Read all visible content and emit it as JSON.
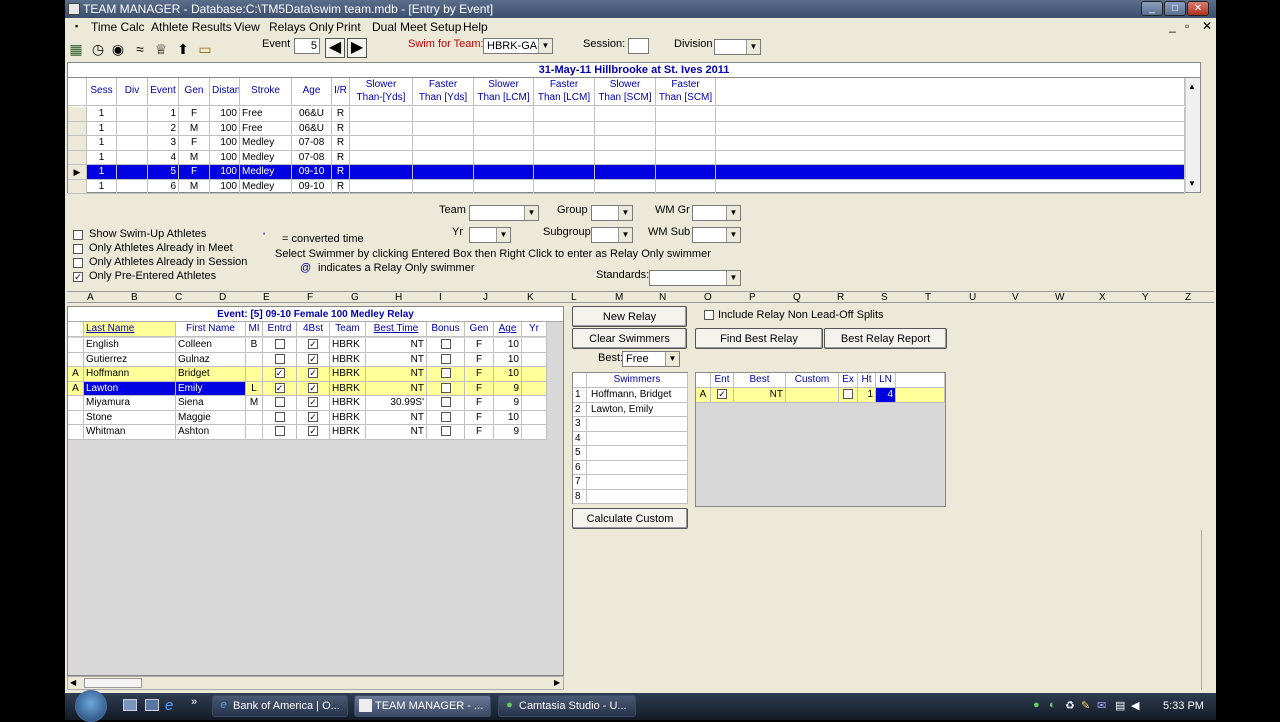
{
  "window": {
    "title": "TEAM MANAGER - Database:C:\\TM5Data\\swim team.mdb - [Entry by Event]"
  },
  "menu": [
    "Time Calc",
    "Athlete Results",
    "View",
    "Relays Only",
    "Print",
    "Dual Meet Setup",
    "Help"
  ],
  "toolbar": {
    "event_label": "Event",
    "event_value": "5",
    "swim_for_team_label": "Swim for Team:",
    "swim_for_team_value": "HBRK-GA",
    "session_label": "Session:",
    "division_label": "Division"
  },
  "meet": {
    "banner": "31-May-11  Hillbrooke at St. Ives 2011"
  },
  "events_grid": {
    "headers": [
      "Sess",
      "Div",
      "Event",
      "Gen",
      "Distance",
      "Stroke",
      "Age",
      "I/R",
      "Slower Than-[Yds]",
      "Faster Than [Yds]",
      "Slower Than [LCM]",
      "Faster Than [LCM]",
      "Slower Than [SCM]",
      "Faster Than [SCM]"
    ],
    "header_lines": [
      [
        "Sess"
      ],
      [
        "Div"
      ],
      [
        "Event"
      ],
      [
        "Gen"
      ],
      [
        "Distance"
      ],
      [
        "Stroke"
      ],
      [
        "Age"
      ],
      [
        "I/R"
      ],
      [
        "Slower",
        "Than-[Yds]"
      ],
      [
        "Faster",
        "Than [Yds]"
      ],
      [
        "Slower",
        "Than [LCM]"
      ],
      [
        "Faster",
        "Than [LCM]"
      ],
      [
        "Slower",
        "Than [SCM]"
      ],
      [
        "Faster",
        "Than [SCM]"
      ]
    ],
    "rows": [
      {
        "sess": "1",
        "div": "",
        "event": "1",
        "gen": "F",
        "distance": "100",
        "stroke": "Free",
        "age": "06&U",
        "ir": "R"
      },
      {
        "sess": "1",
        "div": "",
        "event": "2",
        "gen": "M",
        "distance": "100",
        "stroke": "Free",
        "age": "06&U",
        "ir": "R"
      },
      {
        "sess": "1",
        "div": "",
        "event": "3",
        "gen": "F",
        "distance": "100",
        "stroke": "Medley",
        "age": "07-08",
        "ir": "R"
      },
      {
        "sess": "1",
        "div": "",
        "event": "4",
        "gen": "M",
        "distance": "100",
        "stroke": "Medley",
        "age": "07-08",
        "ir": "R"
      },
      {
        "sess": "1",
        "div": "",
        "event": "5",
        "gen": "F",
        "distance": "100",
        "stroke": "Medley",
        "age": "09-10",
        "ir": "R"
      },
      {
        "sess": "1",
        "div": "",
        "event": "6",
        "gen": "M",
        "distance": "100",
        "stroke": "Medley",
        "age": "09-10",
        "ir": "R"
      }
    ],
    "selected_index": 4
  },
  "filters": {
    "show_swimup": "Show Swim-Up Athletes",
    "only_in_meet": "Only Athletes Already in Meet",
    "only_in_session": "Only Athletes Already in Session",
    "only_preentered": "Only Pre-Entered Athletes",
    "team_label": "Team",
    "group_label": "Group",
    "wm_gr_label": "WM Gr",
    "yr_label": "Yr",
    "subgroup_label": "Subgroup",
    "wm_sub_label": "WM Sub",
    "standards_label": "Standards:",
    "converted_mark": "'",
    "converted_note": "= converted time",
    "instructions": "Select Swimmer by clicking Entered Box then Right Click to enter as Relay Only swimmer",
    "relay_only_mark": "@",
    "relay_only_note": "indicates a Relay Only swimmer"
  },
  "column_letters": [
    "A",
    "B",
    "C",
    "D",
    "E",
    "F",
    "G",
    "H",
    "I",
    "J",
    "K",
    "L",
    "M",
    "N",
    "O",
    "P",
    "Q",
    "R",
    "S",
    "T",
    "U",
    "V",
    "W",
    "X",
    "Y",
    "Z"
  ],
  "athletes": {
    "event_title": "Event: [5]  09-10  Female  100  Medley Relay",
    "headers": [
      "Last Name",
      "First Name",
      "MI",
      "Entrd",
      "4Bst",
      "Team",
      "Best Time",
      "Bonus",
      "Gen",
      "Age",
      "Yr"
    ],
    "rows": [
      {
        "mark": "",
        "last": "English",
        "first": "Colleen",
        "mi": "B",
        "entrd": false,
        "best4": true,
        "team": "HBRK",
        "best_time": "NT",
        "bonus": false,
        "gen": "F",
        "age": "10",
        "yr": ""
      },
      {
        "mark": "",
        "last": "Gutierrez",
        "first": "Gulnaz",
        "mi": "",
        "entrd": false,
        "best4": true,
        "team": "HBRK",
        "best_time": "NT",
        "bonus": false,
        "gen": "F",
        "age": "10",
        "yr": ""
      },
      {
        "mark": "A",
        "last": "Hoffmann",
        "first": "Bridget",
        "mi": "",
        "entrd": true,
        "best4": true,
        "team": "HBRK",
        "best_time": "NT",
        "bonus": false,
        "gen": "F",
        "age": "10",
        "yr": ""
      },
      {
        "mark": "A",
        "last": "Lawton",
        "first": "Emily",
        "mi": "L",
        "entrd": true,
        "best4": true,
        "team": "HBRK",
        "best_time": "NT",
        "bonus": false,
        "gen": "F",
        "age": "9",
        "yr": ""
      },
      {
        "mark": "",
        "last": "Miyamura",
        "first": "Siena",
        "mi": "M",
        "entrd": false,
        "best4": true,
        "team": "HBRK",
        "best_time": "30.99S'",
        "bonus": false,
        "gen": "F",
        "age": "9",
        "yr": ""
      },
      {
        "mark": "",
        "last": "Stone",
        "first": "Maggie",
        "mi": "",
        "entrd": false,
        "best4": true,
        "team": "HBRK",
        "best_time": "NT",
        "bonus": false,
        "gen": "F",
        "age": "10",
        "yr": ""
      },
      {
        "mark": "",
        "last": "Whitman",
        "first": "Ashton",
        "mi": "",
        "entrd": false,
        "best4": true,
        "team": "HBRK",
        "best_time": "NT",
        "bonus": false,
        "gen": "F",
        "age": "9",
        "yr": ""
      }
    ]
  },
  "relay": {
    "new_relay": "New Relay",
    "clear_swimmers": "Clear Swimmers",
    "best_label": "Best:",
    "best_value": "Free",
    "include_nonleadoff": "Include Relay Non Lead-Off Splits",
    "find_best": "Find Best Relay",
    "best_report": "Best Relay Report",
    "swimmers_header": "Swimmers",
    "swimmers": [
      {
        "n": "1",
        "name": "Hoffmann, Bridget"
      },
      {
        "n": "2",
        "name": "Lawton, Emily"
      },
      {
        "n": "3",
        "name": ""
      },
      {
        "n": "4",
        "name": ""
      },
      {
        "n": "5",
        "name": ""
      },
      {
        "n": "6",
        "name": ""
      },
      {
        "n": "7",
        "name": ""
      },
      {
        "n": "8",
        "name": ""
      }
    ],
    "calculate_custom": "Calculate Custom",
    "entries_headers": [
      "Ent",
      "Best",
      "Custom",
      "Ex",
      "Ht",
      "LN"
    ],
    "entries": [
      {
        "mark": "A",
        "ent": true,
        "best": "NT",
        "custom": "",
        "ex": false,
        "ht": "1",
        "ln": "4"
      }
    ]
  },
  "taskbar": {
    "tasks": [
      "Bank of America | O...",
      "TEAM MANAGER - ...",
      "Camtasia Studio - U..."
    ],
    "clock": "5:33 PM"
  }
}
